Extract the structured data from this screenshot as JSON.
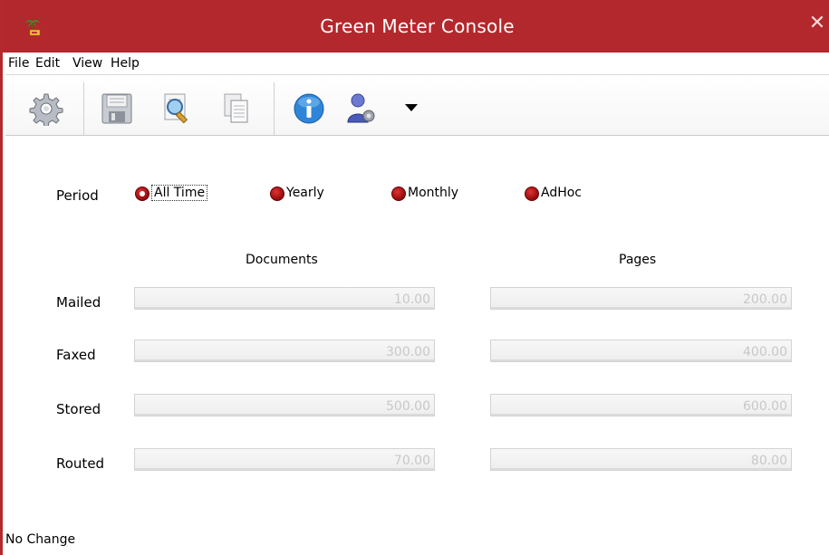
{
  "window": {
    "title": "Green Meter Console"
  },
  "menu": {
    "items": [
      "File",
      "Edit",
      "View",
      "Help"
    ]
  },
  "toolbar": {
    "buttons": [
      "gear-icon",
      "save-icon",
      "search-document-icon",
      "copy-pages-icon",
      "info-icon",
      "user-settings-icon",
      "dropdown-arrow-icon"
    ]
  },
  "period": {
    "label": "Period",
    "options": [
      "All Time",
      "Yearly",
      "Monthly",
      "AdHoc"
    ],
    "selected": "All Time"
  },
  "headers": {
    "documents": "Documents",
    "pages": "Pages"
  },
  "rows": [
    {
      "label": "Mailed",
      "documents": "10.00",
      "pages": "200.00"
    },
    {
      "label": "Faxed",
      "documents": "300.00",
      "pages": "400.00"
    },
    {
      "label": "Stored",
      "documents": "500.00",
      "pages": "600.00"
    },
    {
      "label": "Routed",
      "documents": "70.00",
      "pages": "80.00"
    }
  ],
  "status": {
    "text": "No Change"
  },
  "colors": {
    "titlebar": "#b3282c",
    "radio": "#a01010"
  }
}
